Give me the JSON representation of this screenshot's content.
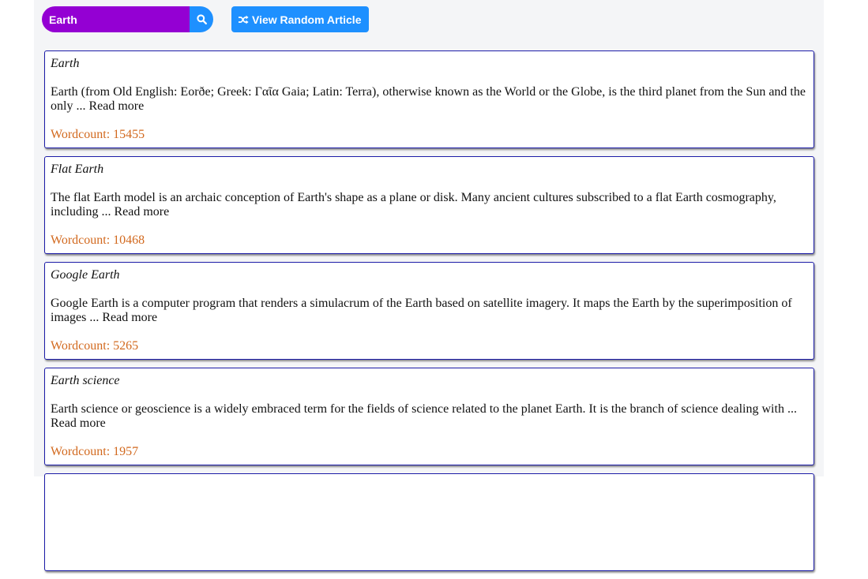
{
  "search": {
    "value": "Earth"
  },
  "random_button": {
    "label": "View Random Article"
  },
  "results": [
    {
      "title": "Earth",
      "snippet": "Earth (from Old English: Eorðe; Greek: Γαῖα Gaia; Latin: Terra), otherwise known as the World or the Globe, is the third planet from the Sun and the only ... Read more",
      "wordcount": "Wordcount: 15455"
    },
    {
      "title": "Flat Earth",
      "snippet": "The flat Earth model is an archaic conception of Earth's shape as a plane or disk. Many ancient cultures subscribed to a flat Earth cosmography, including ... Read more",
      "wordcount": "Wordcount: 10468"
    },
    {
      "title": "Google Earth",
      "snippet": "Google Earth is a computer program that renders a simulacrum of the Earth based on satellite imagery. It maps the Earth by the superimposition of images ... Read more",
      "wordcount": "Wordcount: 5265"
    },
    {
      "title": "Earth science",
      "snippet": "Earth science or geoscience is a widely embraced term for the fields of science related to the planet Earth. It is the branch of science dealing with ... Read more",
      "wordcount": "Wordcount: 1957"
    }
  ],
  "icons": {
    "search": "search-icon",
    "shuffle": "shuffle-icon"
  },
  "colors": {
    "search_bg": "#9400d3",
    "accent": "#1e90ff",
    "card_border": "#1c1ca8",
    "wordcount": "#d2691e"
  }
}
